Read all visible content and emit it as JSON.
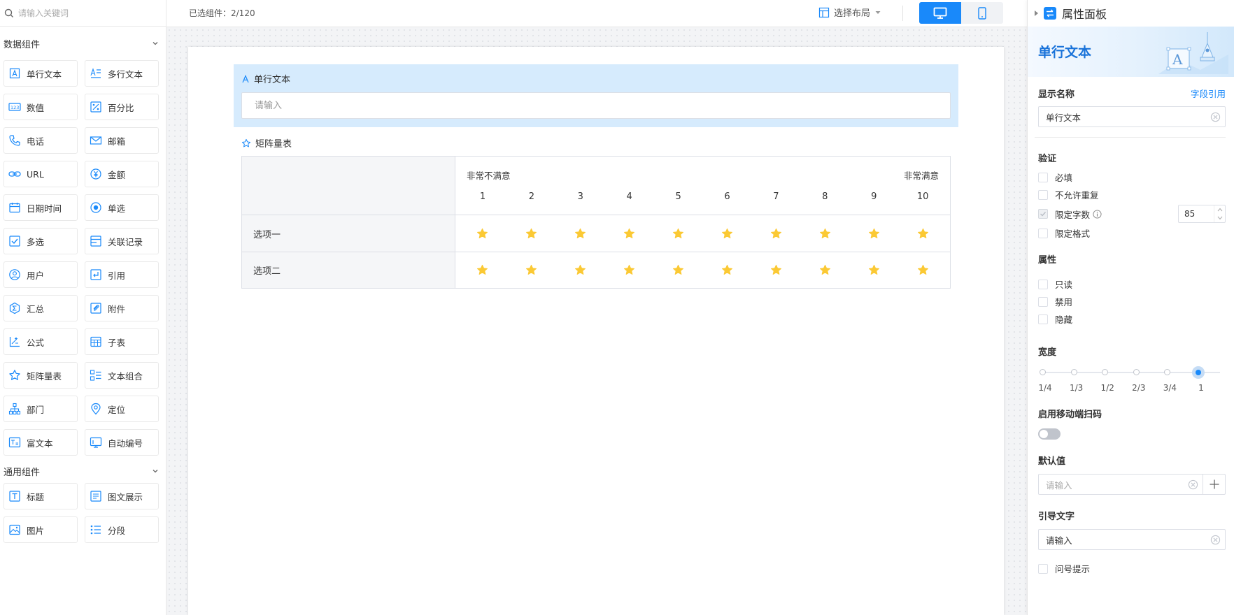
{
  "sidebar": {
    "search_placeholder": "请输入关键词",
    "data_group_title": "数据组件",
    "data_components": [
      {
        "label": "单行文本",
        "icon": "single-line-text-icon"
      },
      {
        "label": "多行文本",
        "icon": "multi-line-text-icon"
      },
      {
        "label": "数值",
        "icon": "number-icon"
      },
      {
        "label": "百分比",
        "icon": "percentage-icon"
      },
      {
        "label": "电话",
        "icon": "phone-icon"
      },
      {
        "label": "邮箱",
        "icon": "email-icon"
      },
      {
        "label": "URL",
        "icon": "link-icon"
      },
      {
        "label": "金额",
        "icon": "currency-icon"
      },
      {
        "label": "日期时间",
        "icon": "calendar-icon"
      },
      {
        "label": "单选",
        "icon": "radio-icon"
      },
      {
        "label": "多选",
        "icon": "checkbox-icon"
      },
      {
        "label": "关联记录",
        "icon": "related-record-icon"
      },
      {
        "label": "用户",
        "icon": "user-icon"
      },
      {
        "label": "引用",
        "icon": "quote-icon"
      },
      {
        "label": "汇总",
        "icon": "sum-icon"
      },
      {
        "label": "附件",
        "icon": "attachment-icon"
      },
      {
        "label": "公式",
        "icon": "formula-icon"
      },
      {
        "label": "子表",
        "icon": "subtable-icon"
      },
      {
        "label": "矩阵量表",
        "icon": "star-icon"
      },
      {
        "label": "文本组合",
        "icon": "text-combination-icon"
      },
      {
        "label": "部门",
        "icon": "org-chart-icon"
      },
      {
        "label": "定位",
        "icon": "location-pin-icon"
      },
      {
        "label": "富文本",
        "icon": "rich-text-icon"
      },
      {
        "label": "自动编号",
        "icon": "auto-number-icon"
      }
    ],
    "general_group_title": "通用组件",
    "general_components": [
      {
        "label": "标题",
        "icon": "title-icon"
      },
      {
        "label": "图文展示",
        "icon": "image-text-icon"
      },
      {
        "label": "图片",
        "icon": "image-icon"
      },
      {
        "label": "分段",
        "icon": "section-list-icon"
      }
    ]
  },
  "topbar": {
    "selected_count": "已选组件：2/120",
    "layout_select_label": "选择布局"
  },
  "form": {
    "text_field_label": "单行文本",
    "text_field_placeholder": "请输入",
    "matrix_label": "矩阵量表",
    "scale_low_label": "非常不满意",
    "scale_high_label": "非常满意",
    "scale_values": [
      "1",
      "2",
      "3",
      "4",
      "5",
      "6",
      "7",
      "8",
      "9",
      "10"
    ],
    "rows": [
      "选项一",
      "选项二"
    ],
    "star_color": "#fbc934"
  },
  "panel": {
    "title": "属性面板",
    "banner_title": "单行文本",
    "display_name_label": "显示名称",
    "field_ref_link": "字段引用",
    "display_name_value": "单行文本",
    "validation_title": "验证",
    "validation_options": [
      {
        "label": "必填",
        "checked": false
      },
      {
        "label": "不允许重复",
        "checked": false
      },
      {
        "label": "限定字数",
        "checked": true
      },
      {
        "label": "限定格式",
        "checked": false
      }
    ],
    "char_limit_value": "85",
    "properties_title": "属性",
    "property_options": [
      "只读",
      "禁用",
      "隐藏"
    ],
    "width_title": "宽度",
    "width_options": [
      "1/4",
      "1/3",
      "1/2",
      "2/3",
      "3/4",
      "1"
    ],
    "width_selected": "1",
    "mobile_scan_title": "启用移动端扫码",
    "mobile_scan_enabled": false,
    "default_value_title": "默认值",
    "default_value_placeholder": "请输入",
    "guide_text_title": "引导文字",
    "guide_text_value": "请输入",
    "tooltip_option_label": "问号提示"
  },
  "colors": {
    "accent": "#1989fa",
    "selected_field_bg": "#d6ebfd",
    "star": "#fbc934"
  }
}
